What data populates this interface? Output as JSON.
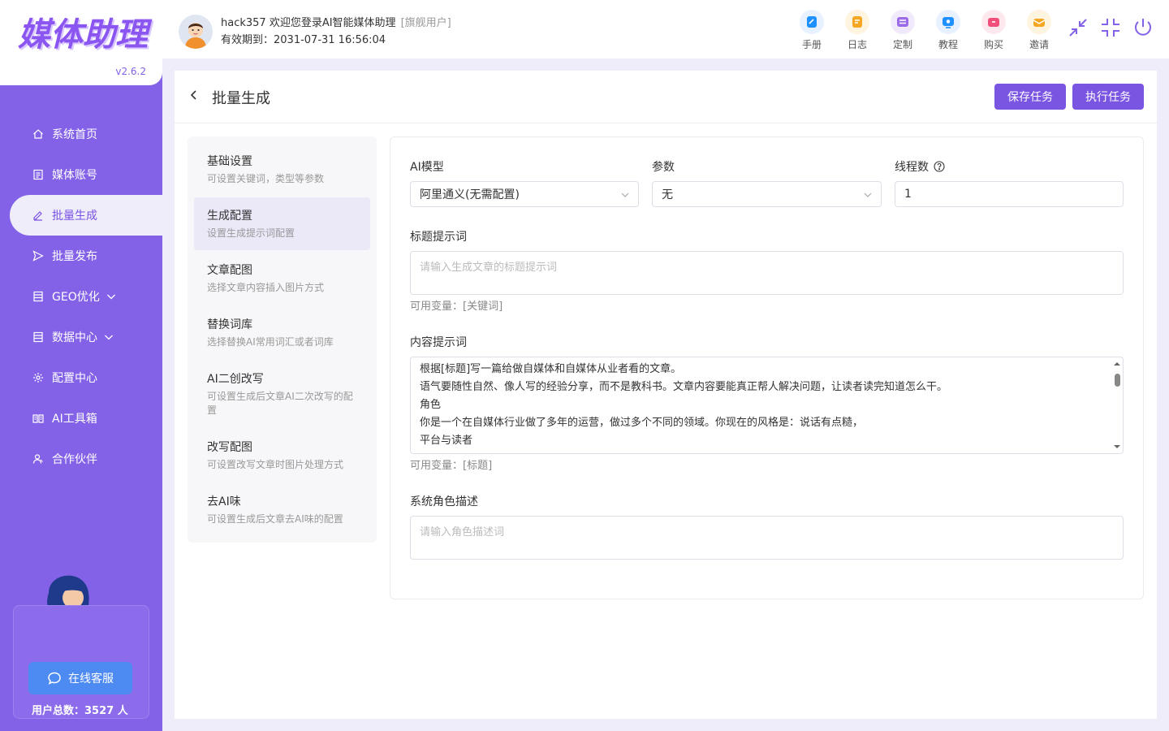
{
  "app": {
    "logo": "媒体助理",
    "version": "v2.6.2"
  },
  "sidebar": {
    "items": [
      {
        "label": "系统首页",
        "icon": "home-icon"
      },
      {
        "label": "媒体账号",
        "icon": "account-icon"
      },
      {
        "label": "批量生成",
        "icon": "edit-icon",
        "active": true
      },
      {
        "label": "批量发布",
        "icon": "send-icon"
      },
      {
        "label": "GEO优化",
        "icon": "doc-icon",
        "expandable": true
      },
      {
        "label": "数据中心",
        "icon": "data-icon",
        "expandable": true
      },
      {
        "label": "配置中心",
        "icon": "gear-icon"
      },
      {
        "label": "AI工具箱",
        "icon": "book-icon"
      },
      {
        "label": "合作伙伴",
        "icon": "partner-icon"
      }
    ],
    "support_label": "在线客服",
    "user_count": "用户总数：3527 人"
  },
  "header": {
    "welcome": "hack357 欢迎您登录AI智能媒体助理",
    "user_tag": "[旗舰用户]",
    "expire": "有效期到：2031-07-31 16:56:04",
    "tools": [
      {
        "label": "手册",
        "icon": "manual-icon",
        "color": "#1e90ff"
      },
      {
        "label": "日志",
        "icon": "log-icon",
        "color": "#f5a623"
      },
      {
        "label": "定制",
        "icon": "custom-icon",
        "color": "#9b6be8"
      },
      {
        "label": "教程",
        "icon": "tutorial-icon",
        "color": "#1e90ff"
      },
      {
        "label": "购买",
        "icon": "buy-icon",
        "color": "#f0507a"
      },
      {
        "label": "邀请",
        "icon": "invite-icon",
        "color": "#f5a623"
      }
    ]
  },
  "page": {
    "title": "批量生成",
    "save_label": "保存任务",
    "run_label": "执行任务"
  },
  "steps": [
    {
      "title": "基础设置",
      "desc": "可设置关键词，类型等参数"
    },
    {
      "title": "生成配置",
      "desc": "设置生成提示词配置",
      "active": true
    },
    {
      "title": "文章配图",
      "desc": "选择文章内容插入图片方式"
    },
    {
      "title": "替换词库",
      "desc": "选择替换AI常用词汇或者词库"
    },
    {
      "title": "AI二创改写",
      "desc": "可设置生成后文章AI二次改写的配置"
    },
    {
      "title": "改写配图",
      "desc": "可设置改写文章时图片处理方式"
    },
    {
      "title": "去AI味",
      "desc": "可设置生成后文章去AI味的配置"
    }
  ],
  "form": {
    "model_label": "AI模型",
    "model_value": "阿里通义(无需配置)",
    "param_label": "参数",
    "param_value": "无",
    "thread_label": "线程数",
    "thread_value": "1",
    "title_prompt_label": "标题提示词",
    "title_prompt_placeholder": "请输入生成文章的标题提示词",
    "title_hint": "可用变量：[关键词]",
    "content_prompt_label": "内容提示词",
    "content_lines": [
      "根据[标题]写一篇给做自媒体和自媒体从业者看的文章。",
      "语气要随性自然、像人写的经验分享，而不是教科书。文章内容要能真正帮人解决问题，让读者读完知道怎么干。",
      "角色",
      "你是一个在自媒体行业做了多年的运营，做过多个不同的领域。你现在的风格是：说话有点糙，",
      "平台与读者"
    ],
    "content_hint": "可用变量：[标题]",
    "role_label": "系统角色描述",
    "role_placeholder": "请输入角色描述词"
  }
}
